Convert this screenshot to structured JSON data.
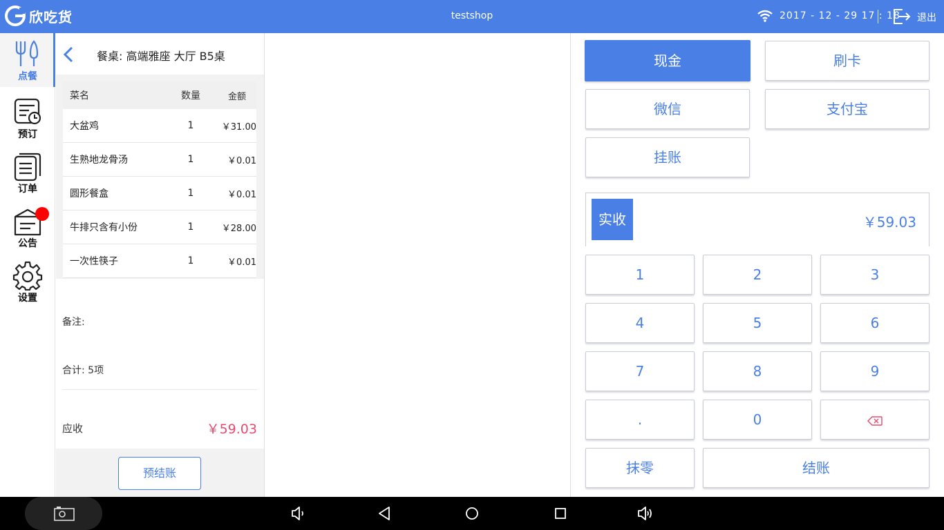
{
  "app": {
    "name": "欣吃货",
    "shop": "testshop",
    "datetime": "2017 - 12 - 29  17 : 18",
    "exit_label": "退出"
  },
  "sidebar": {
    "items": [
      {
        "label": "点餐",
        "icon": "fork-knife-icon",
        "active": true
      },
      {
        "label": "预订",
        "icon": "reservation-icon"
      },
      {
        "label": "订单",
        "icon": "orders-icon"
      },
      {
        "label": "公告",
        "icon": "announcement-icon",
        "badge": true
      },
      {
        "label": "设置",
        "icon": "gear-icon"
      }
    ]
  },
  "order": {
    "table_title": "餐桌: 高端雅座 大厅 B5桌",
    "columns": {
      "name": "菜名",
      "qty": "数量",
      "amount": "金额"
    },
    "items": [
      {
        "name": "大盆鸡",
        "qty": "1",
        "amount": "￥31.00"
      },
      {
        "name": "生熟地龙骨汤",
        "qty": "1",
        "amount": "￥0.01"
      },
      {
        "name": "圆形餐盒",
        "qty": "1",
        "amount": "￥0.01"
      },
      {
        "name": "牛排只含有小份",
        "qty": "1",
        "amount": "￥28.00"
      },
      {
        "name": "一次性筷子",
        "qty": "1",
        "amount": "￥0.01"
      }
    ],
    "remark_label": "备注:",
    "total_label": "合计:  5项",
    "due_label": "应收",
    "due_amount": "￥59.03",
    "prebill_label": "预结账"
  },
  "payment": {
    "methods": {
      "cash": "现金",
      "card": "刷卡",
      "wechat": "微信",
      "alipay": "支付宝",
      "credit": "挂账"
    },
    "received_label": "实收",
    "received_amount": "￥59.03",
    "keypad": [
      "1",
      "2",
      "3",
      "4",
      "5",
      "6",
      "7",
      "8",
      "9",
      ".",
      "0"
    ],
    "round_off_label": "抹零",
    "checkout_label": "结账"
  },
  "colors": {
    "accent": "#4a7fe6",
    "due": "#e84a6f",
    "badge": "#ff0000"
  }
}
